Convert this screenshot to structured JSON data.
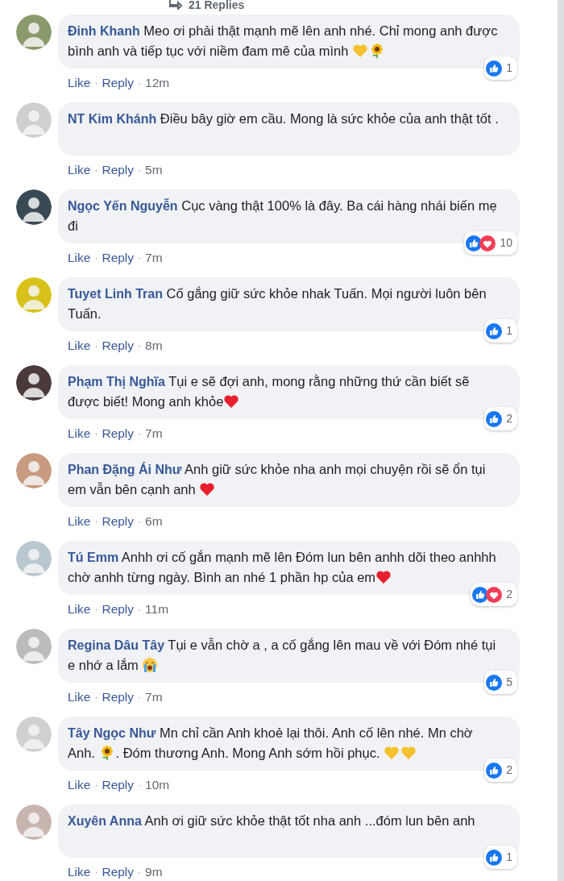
{
  "replies_link": {
    "label": "21 Replies"
  },
  "comments": [
    {
      "author": "Đinh Khanh",
      "parts": [
        {
          "kind": "text",
          "text": "Meo ơi phải thật mạnh mẽ lên anh nhé. Chỉ mong anh được bình anh và tiếp tục với niềm đam mê của mình "
        },
        {
          "kind": "heart",
          "color": "#f5c12e"
        },
        {
          "kind": "sunflower"
        }
      ],
      "meta": [
        "Like",
        "·",
        "Reply",
        "·",
        "12m"
      ],
      "reactions": {
        "icons": [
          {
            "kind": "like"
          }
        ],
        "count": "1"
      }
    },
    {
      "author": "NT Kim Khánh",
      "parts": [
        {
          "kind": "text",
          "text": "Điều bây giờ em cầu. Mong là sức khỏe của anh thật tốt ."
        }
      ],
      "meta": [
        "Like",
        "·",
        "Reply",
        "·",
        "5m"
      ]
    },
    {
      "author": "Ngọc Yến Nguyễn",
      "parts": [
        {
          "kind": "text",
          "text": "Cục vàng thật 100% là đây. Ba cái hàng nhái biến mẹ đi"
        }
      ],
      "meta": [
        "Like",
        "·",
        "Reply",
        "·",
        "7m"
      ],
      "reactions": {
        "icons": [
          {
            "kind": "like"
          },
          {
            "kind": "love"
          }
        ],
        "count": "10"
      }
    },
    {
      "author": "Tuyet Linh Tran",
      "parts": [
        {
          "kind": "text",
          "text": "Cố gắng giữ sức khỏe nhak Tuấn. Mọi người luôn bên Tuấn."
        }
      ],
      "meta": [
        "Like",
        "·",
        "Reply",
        "·",
        "8m"
      ],
      "reactions": {
        "icons": [
          {
            "kind": "like"
          }
        ],
        "count": "1"
      }
    },
    {
      "author": "Phạm Thị Nghĩa",
      "parts": [
        {
          "kind": "text",
          "text": "Tụi e sẽ đợi anh, mong rằng những thứ cần biết sẽ được biết! Mong anh khỏe"
        },
        {
          "kind": "heart",
          "color": "#e8202d"
        }
      ],
      "meta": [
        "Like",
        "·",
        "Reply",
        "·",
        "7m"
      ],
      "reactions": {
        "icons": [
          {
            "kind": "like"
          }
        ],
        "count": "2"
      }
    },
    {
      "author": "Phan Đặng Ái Như",
      "parts": [
        {
          "kind": "text",
          "text": "Anh giữ sức khỏe nha anh mọi chuyện rồi sẽ ổn tụi em vẫn bên cạnh anh "
        },
        {
          "kind": "heart",
          "color": "#e8202d"
        }
      ],
      "meta": [
        "Like",
        "·",
        "Reply",
        "·",
        "6m"
      ]
    },
    {
      "author": "Tú Emm",
      "parts": [
        {
          "kind": "text",
          "text": "Anhh ơi cố gắn mạnh mẽ lên Đóm lun bên anhh dõi theo anhhh chờ anhh từng ngày. Bình an nhé 1 phần hp của em"
        },
        {
          "kind": "heart",
          "color": "#e8202d"
        }
      ],
      "meta": [
        "Like",
        "·",
        "Reply",
        "·",
        "11m"
      ],
      "reactions": {
        "icons": [
          {
            "kind": "like"
          },
          {
            "kind": "love"
          }
        ],
        "count": "2"
      }
    },
    {
      "author": "Regina Dâu Tây",
      "parts": [
        {
          "kind": "text",
          "text": "Tụi e vẫn chờ a , a cố gắng lên mau về với Đóm nhé tụi e nhớ a lắm "
        },
        {
          "kind": "crying"
        }
      ],
      "meta": [
        "Like",
        "·",
        "Reply",
        "·",
        "7m"
      ],
      "reactions": {
        "icons": [
          {
            "kind": "like"
          }
        ],
        "count": "5"
      }
    },
    {
      "author": "Tây Ngọc Như",
      "parts": [
        {
          "kind": "text",
          "text": "Mn chỉ cần Anh khoẻ lại thôi. Anh cố lên nhé. Mn chờ Anh. "
        },
        {
          "kind": "sunflower"
        },
        {
          "kind": "text",
          "text": ". Đóm thương Anh. Mong Anh sớm hồi phục. "
        },
        {
          "kind": "heart",
          "color": "#f5c12e"
        },
        {
          "kind": "heart",
          "color": "#f5c12e"
        }
      ],
      "meta": [
        "Like",
        "·",
        "Reply",
        "·",
        "10m"
      ],
      "reactions": {
        "icons": [
          {
            "kind": "like"
          }
        ],
        "count": "2"
      }
    },
    {
      "author": "Xuyên Anna",
      "parts": [
        {
          "kind": "text",
          "text": "Anh ơi giữ sức khỏe thật tốt nha anh ...đóm lun bên anh"
        }
      ],
      "meta": [
        "Like",
        "·",
        "Reply",
        "·",
        "9m"
      ],
      "reactions": {
        "icons": [
          {
            "kind": "like"
          }
        ],
        "count": "1"
      }
    }
  ]
}
